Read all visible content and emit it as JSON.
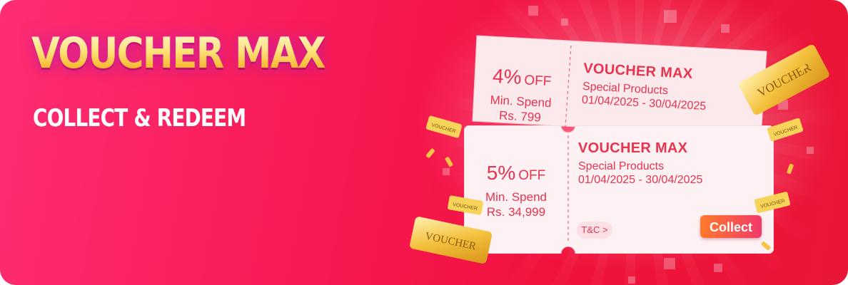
{
  "banner": {
    "title": "VOUCHER MAX",
    "subtitle": "COLLECT & REDEEM"
  },
  "vouchers": [
    {
      "percent": "4%",
      "off": "OFF",
      "min_label": "Min. Spend",
      "min_amount": "Rs. 799",
      "name": "VOUCHER MAX",
      "category": "Special Products",
      "dates": "01/04/2025 - 30/04/2025"
    },
    {
      "percent": "5%",
      "off": "OFF",
      "min_label": "Min. Spend",
      "min_amount": "Rs. 34,999",
      "name": "VOUCHER MAX",
      "category": "Special Products",
      "dates": "01/04/2025 - 30/04/2025",
      "tnc": "T&C >",
      "collect": "Collect"
    }
  ],
  "decor": {
    "ticket_text": "VOUCHER",
    "small_ticket_text": "VOUCHER"
  },
  "colors": {
    "background": "#f7174f",
    "voucher_text": "#e8344f",
    "gold": "#f6b52a",
    "collect_gradient_start": "#ff7a2a",
    "collect_gradient_end": "#f23a6a"
  }
}
